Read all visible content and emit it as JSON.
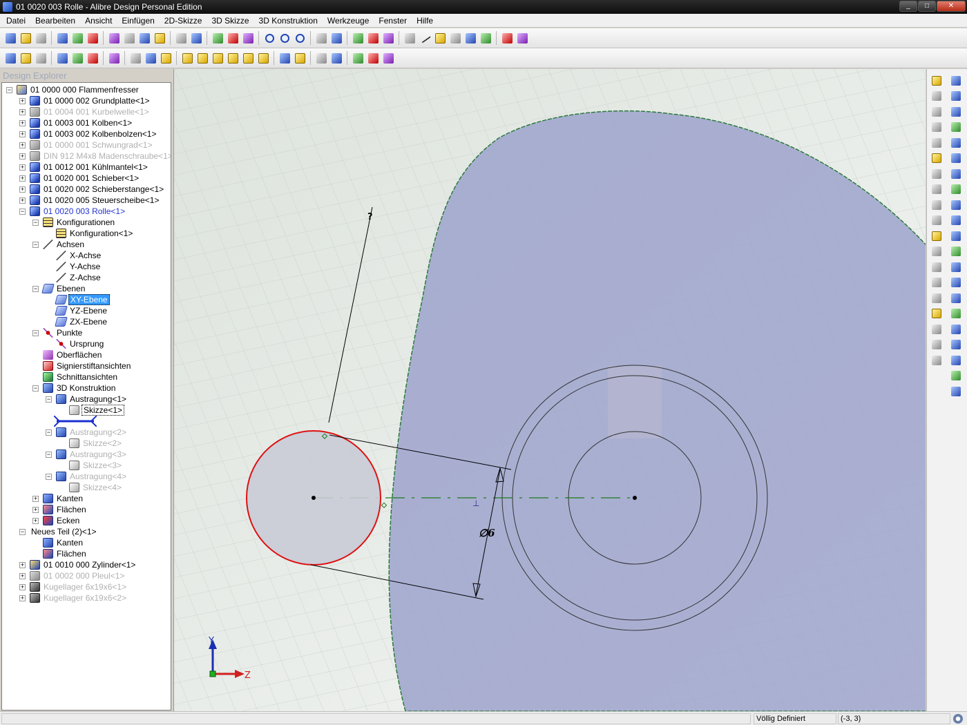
{
  "window": {
    "title": "01 0020 003 Rolle - Alibre Design Personal Edition",
    "buttons": [
      "_",
      "□",
      "✕"
    ]
  },
  "menu": [
    "Datei",
    "Bearbeiten",
    "Ansicht",
    "Einfügen",
    "2D-Skizze",
    "3D Skizze",
    "3D Konstruktion",
    "Werkzeuge",
    "Fenster",
    "Hilfe"
  ],
  "toolbar1": [
    "new-icon",
    "open-icon",
    "save-icon",
    "open-folder-icon",
    "print-preview-icon",
    "print-icon",
    "cut-icon",
    "copy-icon",
    "paste-icon",
    "delete-icon",
    "undo-icon",
    "redo-icon",
    "select-icon",
    "pan-icon",
    "rotate-icon",
    "zoom-in-icon",
    "zoom-window-icon",
    "zoom-fit-icon",
    "previous-view-icon",
    "next-view-icon",
    "insert-part-icon",
    "constraint-icon",
    "render-icon",
    "plane-icon",
    "axis-icon",
    "point-icon",
    "feature-icon",
    "list-icon",
    "export-icon",
    "measure-icon",
    "balance-icon"
  ],
  "toolbar2": [
    "view-front-icon",
    "view-back-icon",
    "view-top-icon",
    "wireframe-icon",
    "hidden-line-icon",
    "shaded-icon",
    "section-icon",
    "grid-icon",
    "grid-snap-icon",
    "grid-display-icon",
    "iso-view-1-icon",
    "iso-view-2-icon",
    "iso-view-3-icon",
    "iso-view-4-icon",
    "iso-view-5-icon",
    "iso-view-6-icon",
    "normal-to-icon",
    "flip-icon",
    "dimension-icon",
    "constraint-show-icon",
    "sketch-tools-icon",
    "sketch-draw-icon",
    "sketch-measure-icon"
  ],
  "explorer": {
    "title": "Design Explorer",
    "items": [
      {
        "label": "01 0000 000 Flammenfresser",
        "level": 0,
        "exp": "−",
        "icon": "ti-asm",
        "state": ""
      },
      {
        "label": "01 0000 002 Grundplatte<1>",
        "level": 1,
        "exp": "+",
        "icon": "ti-part",
        "state": ""
      },
      {
        "label": "01 0004 001 Kurbelwelle<1>",
        "level": 1,
        "exp": "+",
        "icon": "ti-part-dim",
        "state": "dim"
      },
      {
        "label": "01 0003 001 Kolben<1>",
        "level": 1,
        "exp": "+",
        "icon": "ti-part",
        "state": ""
      },
      {
        "label": "01 0003 002 Kolbenbolzen<1>",
        "level": 1,
        "exp": "+",
        "icon": "ti-part",
        "state": ""
      },
      {
        "label": "01 0000 001 Schwungrad<1>",
        "level": 1,
        "exp": "+",
        "icon": "ti-part-dim",
        "state": "dim"
      },
      {
        "label": "DIN 912 M4x8 Madenschraube<1>",
        "level": 1,
        "exp": "+",
        "icon": "ti-part-dim",
        "state": "dim"
      },
      {
        "label": "01 0012 001 Kühlmantel<1>",
        "level": 1,
        "exp": "+",
        "icon": "ti-part",
        "state": ""
      },
      {
        "label": "01 0020 001 Schieber<1>",
        "level": 1,
        "exp": "+",
        "icon": "ti-part",
        "state": ""
      },
      {
        "label": "01 0020 002 Schieberstange<1>",
        "level": 1,
        "exp": "+",
        "icon": "ti-part",
        "state": ""
      },
      {
        "label": "01 0020 005 Steuerscheibe<1>",
        "level": 1,
        "exp": "+",
        "icon": "ti-part",
        "state": ""
      },
      {
        "label": "01 0020 003 Rolle<1>",
        "level": 1,
        "exp": "−",
        "icon": "ti-part",
        "state": "active"
      },
      {
        "label": "Konfigurationen",
        "level": 2,
        "exp": "−",
        "icon": "ti-grid",
        "state": ""
      },
      {
        "label": "Konfiguration<1>",
        "level": 3,
        "exp": "",
        "icon": "ti-grid",
        "state": ""
      },
      {
        "label": "Achsen",
        "level": 2,
        "exp": "−",
        "icon": "ti-axis",
        "state": ""
      },
      {
        "label": "X-Achse",
        "level": 3,
        "exp": "",
        "icon": "ti-axis",
        "state": ""
      },
      {
        "label": "Y-Achse",
        "level": 3,
        "exp": "",
        "icon": "ti-axis",
        "state": ""
      },
      {
        "label": "Z-Achse",
        "level": 3,
        "exp": "",
        "icon": "ti-axis",
        "state": ""
      },
      {
        "label": "Ebenen",
        "level": 2,
        "exp": "−",
        "icon": "ti-plane",
        "state": ""
      },
      {
        "label": "XY-Ebene",
        "level": 3,
        "exp": "",
        "icon": "ti-plane",
        "state": "selected"
      },
      {
        "label": "YZ-Ebene",
        "level": 3,
        "exp": "",
        "icon": "ti-plane",
        "state": ""
      },
      {
        "label": "ZX-Ebene",
        "level": 3,
        "exp": "",
        "icon": "ti-plane",
        "state": ""
      },
      {
        "label": "Punkte",
        "level": 2,
        "exp": "−",
        "icon": "ti-point",
        "state": ""
      },
      {
        "label": "Ursprung",
        "level": 3,
        "exp": "",
        "icon": "ti-point",
        "state": ""
      },
      {
        "label": "Oberflächen",
        "level": 2,
        "exp": "",
        "icon": "ti-surface",
        "state": ""
      },
      {
        "label": "Signierstiftansichten",
        "level": 2,
        "exp": "",
        "icon": "ti-sign",
        "state": ""
      },
      {
        "label": "Schnittansichten",
        "level": 2,
        "exp": "",
        "icon": "ti-section",
        "state": ""
      },
      {
        "label": "3D Konstruktion",
        "level": 2,
        "exp": "−",
        "icon": "ti-ext",
        "state": ""
      },
      {
        "label": "Austragung<1>",
        "level": 3,
        "exp": "−",
        "icon": "ti-ext",
        "state": ""
      },
      {
        "label": "Skizze<1>",
        "level": 4,
        "exp": "",
        "icon": "ti-sketch",
        "state": "boxed"
      },
      {
        "label": "",
        "level": 0,
        "exp": "",
        "icon": "",
        "state": "marker"
      },
      {
        "label": "Austragung<2>",
        "level": 3,
        "exp": "−",
        "icon": "ti-ext",
        "state": "dim"
      },
      {
        "label": "Skizze<2>",
        "level": 4,
        "exp": "",
        "icon": "ti-sketch",
        "state": "dim"
      },
      {
        "label": "Austragung<3>",
        "level": 3,
        "exp": "−",
        "icon": "ti-ext",
        "state": "dim"
      },
      {
        "label": "Skizze<3>",
        "level": 4,
        "exp": "",
        "icon": "ti-sketch",
        "state": "dim"
      },
      {
        "label": "Austragung<4>",
        "level": 3,
        "exp": "−",
        "icon": "ti-ext",
        "state": "dim"
      },
      {
        "label": "Skizze<4>",
        "level": 4,
        "exp": "",
        "icon": "ti-sketch",
        "state": "dim"
      },
      {
        "label": "Kanten",
        "level": 2,
        "exp": "+",
        "icon": "ti-edges",
        "state": ""
      },
      {
        "label": "Flächen",
        "level": 2,
        "exp": "+",
        "icon": "ti-faces",
        "state": ""
      },
      {
        "label": "Ecken",
        "level": 2,
        "exp": "+",
        "icon": "ti-corners",
        "state": ""
      },
      {
        "label": "Neues Teil (2)<1>",
        "level": 1,
        "exp": "−",
        "icon": "",
        "state": ""
      },
      {
        "label": "Kanten",
        "level": 2,
        "exp": "",
        "icon": "ti-edges",
        "state": ""
      },
      {
        "label": "Flächen",
        "level": 2,
        "exp": "",
        "icon": "ti-faces",
        "state": ""
      },
      {
        "label": "01 0010 000 Zylinder<1>",
        "level": 1,
        "exp": "+",
        "icon": "ti-cyl",
        "state": ""
      },
      {
        "label": "01 0002 000 Pleul<1>",
        "level": 1,
        "exp": "+",
        "icon": "ti-part-dim",
        "state": "dim"
      },
      {
        "label": "Kugellager 6x19x6<1>",
        "level": 1,
        "exp": "+",
        "icon": "ti-bearing",
        "state": "dim"
      },
      {
        "label": "Kugellager 6x19x6<2>",
        "level": 1,
        "exp": "+",
        "icon": "ti-bearing",
        "state": "dim"
      }
    ]
  },
  "viewport": {
    "dimension_label": "∅6",
    "axis_y_label": "Y",
    "axis_z_label": "Z",
    "colors": {
      "part_fill": "#9ea3cd",
      "sketch_circle": "#dd1111",
      "background": "#e8ebe8",
      "centerline": "#1a7a1a"
    }
  },
  "right_toolbar": {
    "col1": [
      "sketch-edit-icon",
      "add-icon",
      "line-icon",
      "chain-icon",
      "line2-icon",
      "circle-icon",
      "arc-icon",
      "rectangle-icon",
      "spline-icon",
      "point-icon",
      "text-icon",
      "trim-icon",
      "fillet-icon",
      "pattern-icon",
      "offset-icon",
      "text-a-icon",
      "copy-icon",
      "mirror-icon",
      "project-icon"
    ],
    "col2": [
      "extrude-icon",
      "cut-extrude-icon",
      "revolve-icon",
      "cut-revolve-icon",
      "hole-icon",
      "shell-icon",
      "fillet3d-icon",
      "chamfer-icon",
      "thread-icon",
      "loft-icon",
      "sphere-icon",
      "draft-icon",
      "scale-icon",
      "boolean-icon",
      "pattern3d-icon",
      "mirror3d-icon",
      "sheetmetal-icon",
      "equation-icon",
      "constraint2-icon",
      "fx-icon",
      "reference-icon"
    ]
  },
  "status": {
    "state": "Völlig Definiert",
    "coords": "(-3, 3)"
  }
}
